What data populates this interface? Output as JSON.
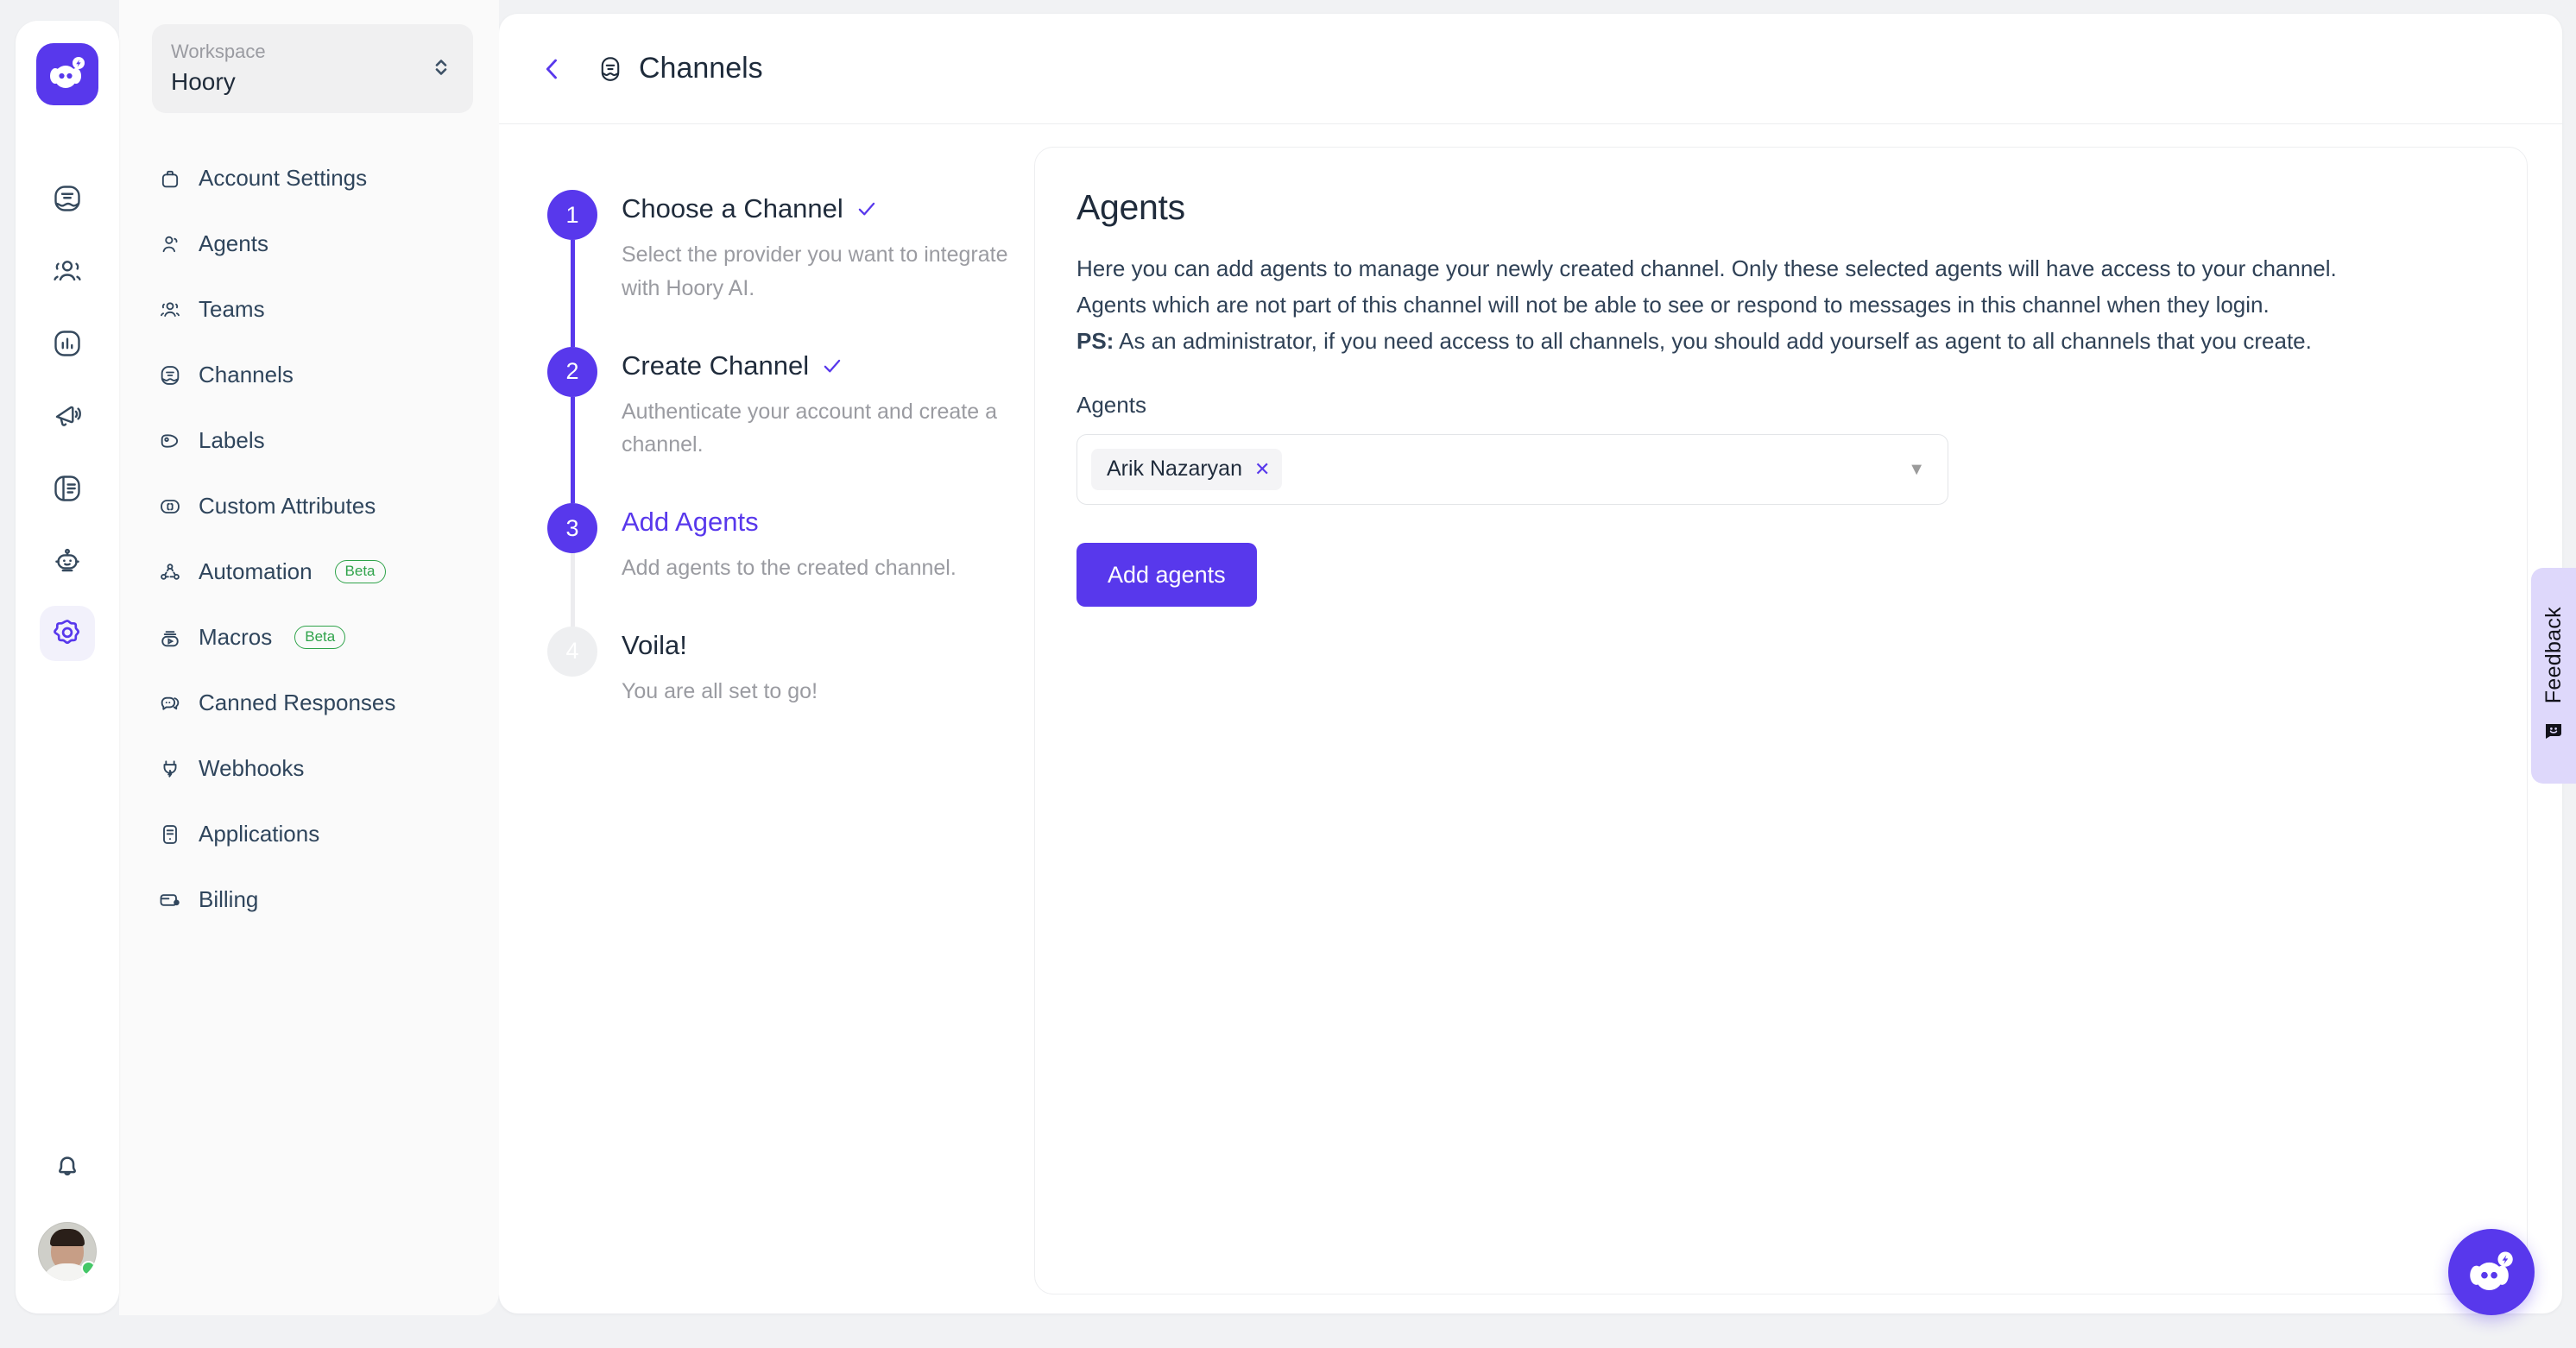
{
  "brand": {
    "accent": "#5838EC",
    "accent_light": "#DED8FB",
    "text_dark": "#1F2B3B",
    "muted": "#9A9BA1",
    "beta_green": "#2FA34A"
  },
  "rail": {
    "logo_icon": "hoory-logo-icon",
    "items": [
      {
        "icon": "conversations-icon",
        "name": "conversations",
        "active": false
      },
      {
        "icon": "contacts-icon",
        "name": "contacts",
        "active": false
      },
      {
        "icon": "reports-icon",
        "name": "reports",
        "active": false
      },
      {
        "icon": "campaigns-megaphone-icon",
        "name": "campaigns",
        "active": false
      },
      {
        "icon": "knowledge-base-icon",
        "name": "knowledge-base",
        "active": false
      },
      {
        "icon": "bot-icon",
        "name": "bot",
        "active": false
      },
      {
        "icon": "gear-icon",
        "name": "settings",
        "active": true
      }
    ],
    "notifications_icon": "bell-icon",
    "avatar_status": "online"
  },
  "sidebar": {
    "workspace_label": "Workspace",
    "workspace_name": "Hoory",
    "items": [
      {
        "label": "Account Settings",
        "icon": "briefcase-icon",
        "beta": ""
      },
      {
        "label": "Agents",
        "icon": "user-icon",
        "beta": ""
      },
      {
        "label": "Teams",
        "icon": "users-icon",
        "beta": ""
      },
      {
        "label": "Channels",
        "icon": "channels-icon",
        "beta": ""
      },
      {
        "label": "Labels",
        "icon": "tag-icon",
        "beta": ""
      },
      {
        "label": "Custom Attributes",
        "icon": "braces-icon",
        "beta": ""
      },
      {
        "label": "Automation",
        "icon": "automation-nodes-icon",
        "beta": "Beta"
      },
      {
        "label": "Macros",
        "icon": "macros-icon",
        "beta": "Beta"
      },
      {
        "label": "Canned Responses",
        "icon": "chat-bubbles-icon",
        "beta": ""
      },
      {
        "label": "Webhooks",
        "icon": "plug-icon",
        "beta": ""
      },
      {
        "label": "Applications",
        "icon": "app-list-icon",
        "beta": ""
      },
      {
        "label": "Billing",
        "icon": "credit-card-icon",
        "beta": ""
      }
    ]
  },
  "header": {
    "back_icon": "chevron-left-icon",
    "title_icon": "channels-icon",
    "title": "Channels"
  },
  "stepper": {
    "steps": [
      {
        "number": "1",
        "title": "Choose a Channel",
        "desc": "Select the provider you want to integrate with Hoory AI.",
        "state": "done"
      },
      {
        "number": "2",
        "title": "Create Channel",
        "desc": "Authenticate your account and create a channel.",
        "state": "done"
      },
      {
        "number": "3",
        "title": "Add Agents",
        "desc": "Add agents to the created channel.",
        "state": "current"
      },
      {
        "number": "4",
        "title": "Voila!",
        "desc": "You are all set to go!",
        "state": "upcoming"
      }
    ]
  },
  "card": {
    "title": "Agents",
    "desc_line1": "Here you can add agents to manage your newly created channel. Only these selected agents will have access to your channel.",
    "desc_line2": "Agents which are not part of this channel will not be able to see or respond to messages in this channel when they login.",
    "desc_ps_label": "PS:",
    "desc_line3": " As an administrator, if you need access to all channels, you should add yourself as agent to all channels that you create.",
    "field_label": "Agents",
    "selected_agents": [
      "Arik Nazaryan"
    ],
    "chip_remove_icon": "close-x-icon",
    "dropdown_icon": "caret-down-icon",
    "submit_label": "Add agents"
  },
  "feedback": {
    "label": "Feedback",
    "icon": "smiley-icon"
  },
  "chat_widget": {
    "icon": "hoory-logo-icon"
  }
}
